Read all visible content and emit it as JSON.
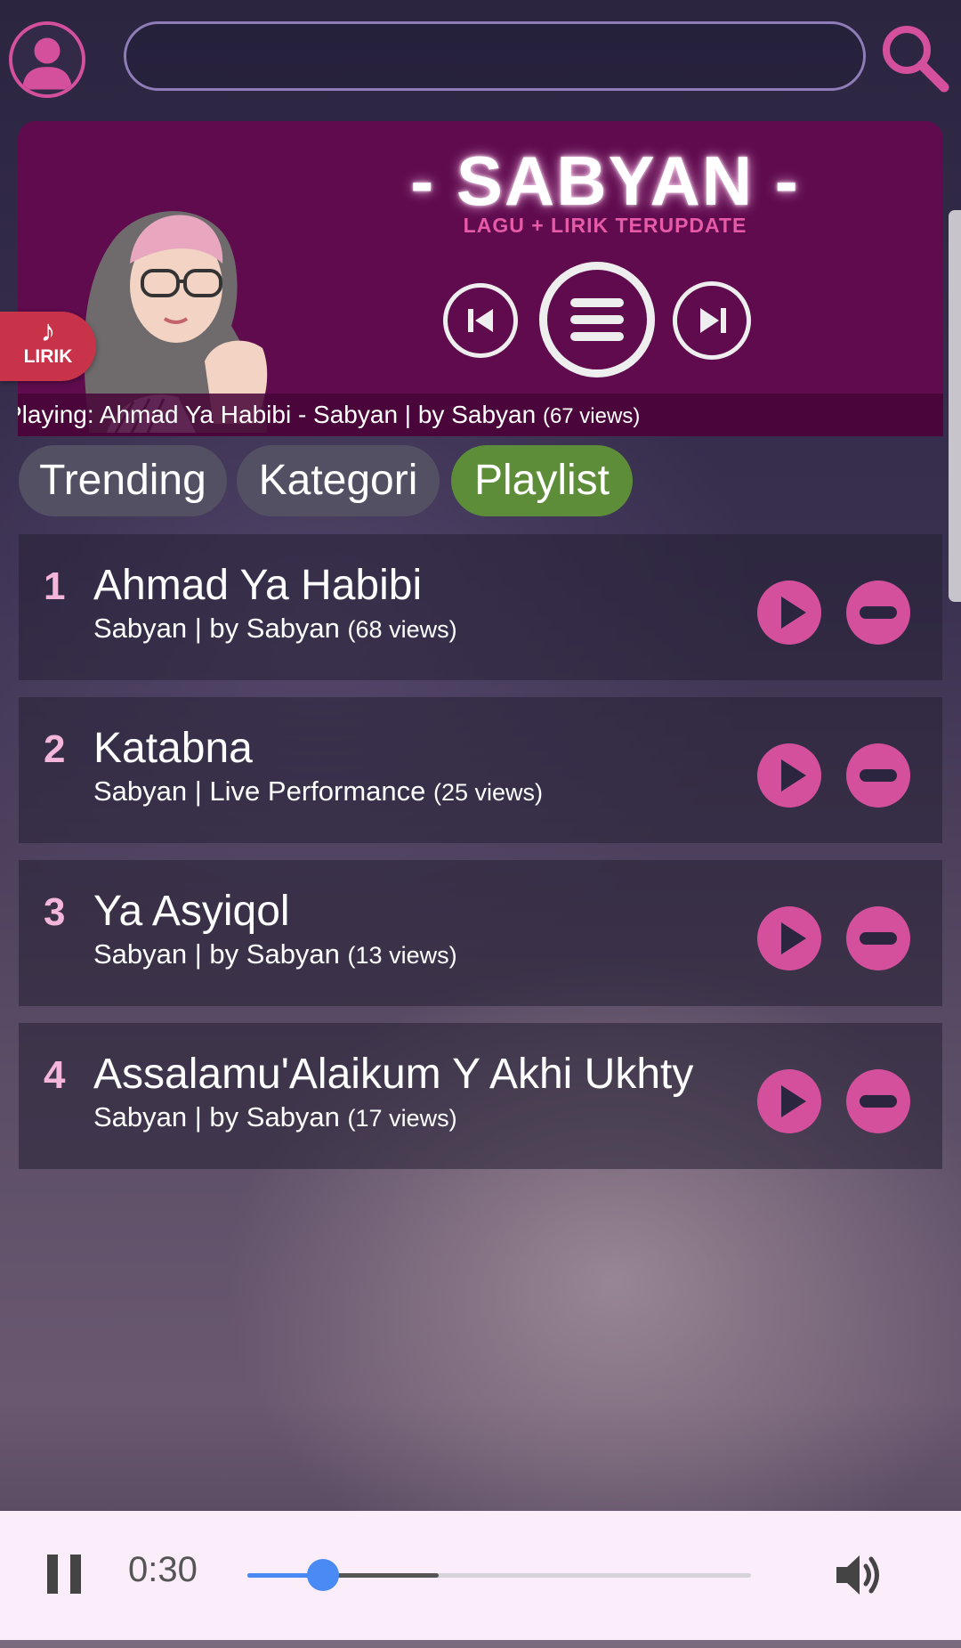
{
  "header": {
    "search_value": "",
    "search_placeholder": ""
  },
  "banner": {
    "brand_title": "- SABYAN -",
    "brand_subtitle": "LAGU + LIRIK TERUPDATE",
    "now_playing_text": "Playing: Ahmad Ya Habibi - Sabyan | by Sabyan",
    "now_playing_views": "(67 views)",
    "lirik_label": "LIRIK",
    "lirik_icon": "music-note-icon"
  },
  "tabs": [
    {
      "label": "Trending",
      "active": false
    },
    {
      "label": "Kategori",
      "active": false
    },
    {
      "label": "Playlist",
      "active": true
    }
  ],
  "playlist": [
    {
      "num": "1",
      "title": "Ahmad Ya Habibi",
      "subtitle": "Sabyan | by Sabyan",
      "views": "(68 views)"
    },
    {
      "num": "2",
      "title": "Katabna",
      "subtitle": "Sabyan | Live Performance",
      "views": "(25 views)"
    },
    {
      "num": "3",
      "title": "Ya Asyiqol",
      "subtitle": "Sabyan | by Sabyan",
      "views": "(13 views)"
    },
    {
      "num": "4",
      "title": "Assalamu'Alaikum Y Akhi Ukhty",
      "subtitle": "Sabyan | by Sabyan",
      "views": "(17 views)"
    }
  ],
  "player": {
    "time": "0:30",
    "progress_fraction": 0.15,
    "buffered_fraction": 0.38,
    "state": "playing"
  },
  "colors": {
    "accent": "#d4509d",
    "banner_bg": "#5f0b4e",
    "tab_active": "#5e8d3a",
    "tab_inactive": "#545063",
    "progress": "#4a8af4"
  }
}
